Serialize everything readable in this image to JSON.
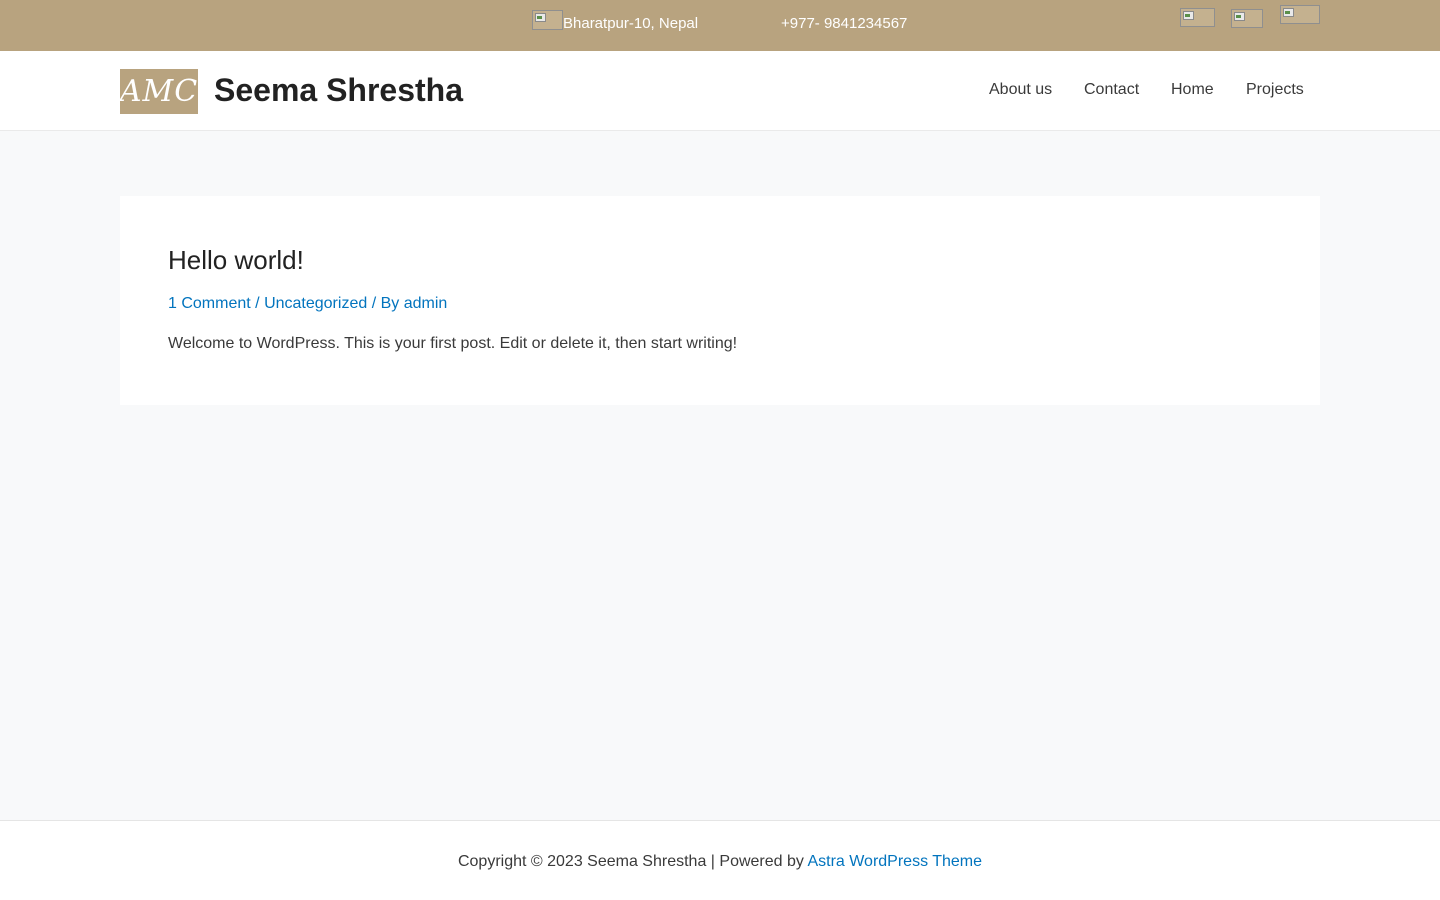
{
  "topbar": {
    "address": "Bharatpur-10, Nepal",
    "phone": "+977- 9841234567",
    "social_icons": [
      "social-icon-1",
      "social-icon-2",
      "social-icon-3"
    ],
    "background": "#b8a37f"
  },
  "header": {
    "logo_text": "AMC",
    "site_title": "Seema Shrestha",
    "nav": [
      "About us",
      "Contact",
      "Home",
      "Projects"
    ]
  },
  "post": {
    "title": "Hello world!",
    "comments": "1 Comment",
    "category": "Uncategorized",
    "by_prefix": "By",
    "author": "admin",
    "separator": "/",
    "excerpt": "Welcome to WordPress. This is your first post. Edit or delete it, then start writing!"
  },
  "footer": {
    "copyright": "Copyright © 2023 Seema Shrestha | Powered by",
    "theme_link": "Astra WordPress Theme"
  },
  "colors": {
    "accent": "#b8a37f",
    "link": "#0274be",
    "background": "#f8f9fa"
  }
}
